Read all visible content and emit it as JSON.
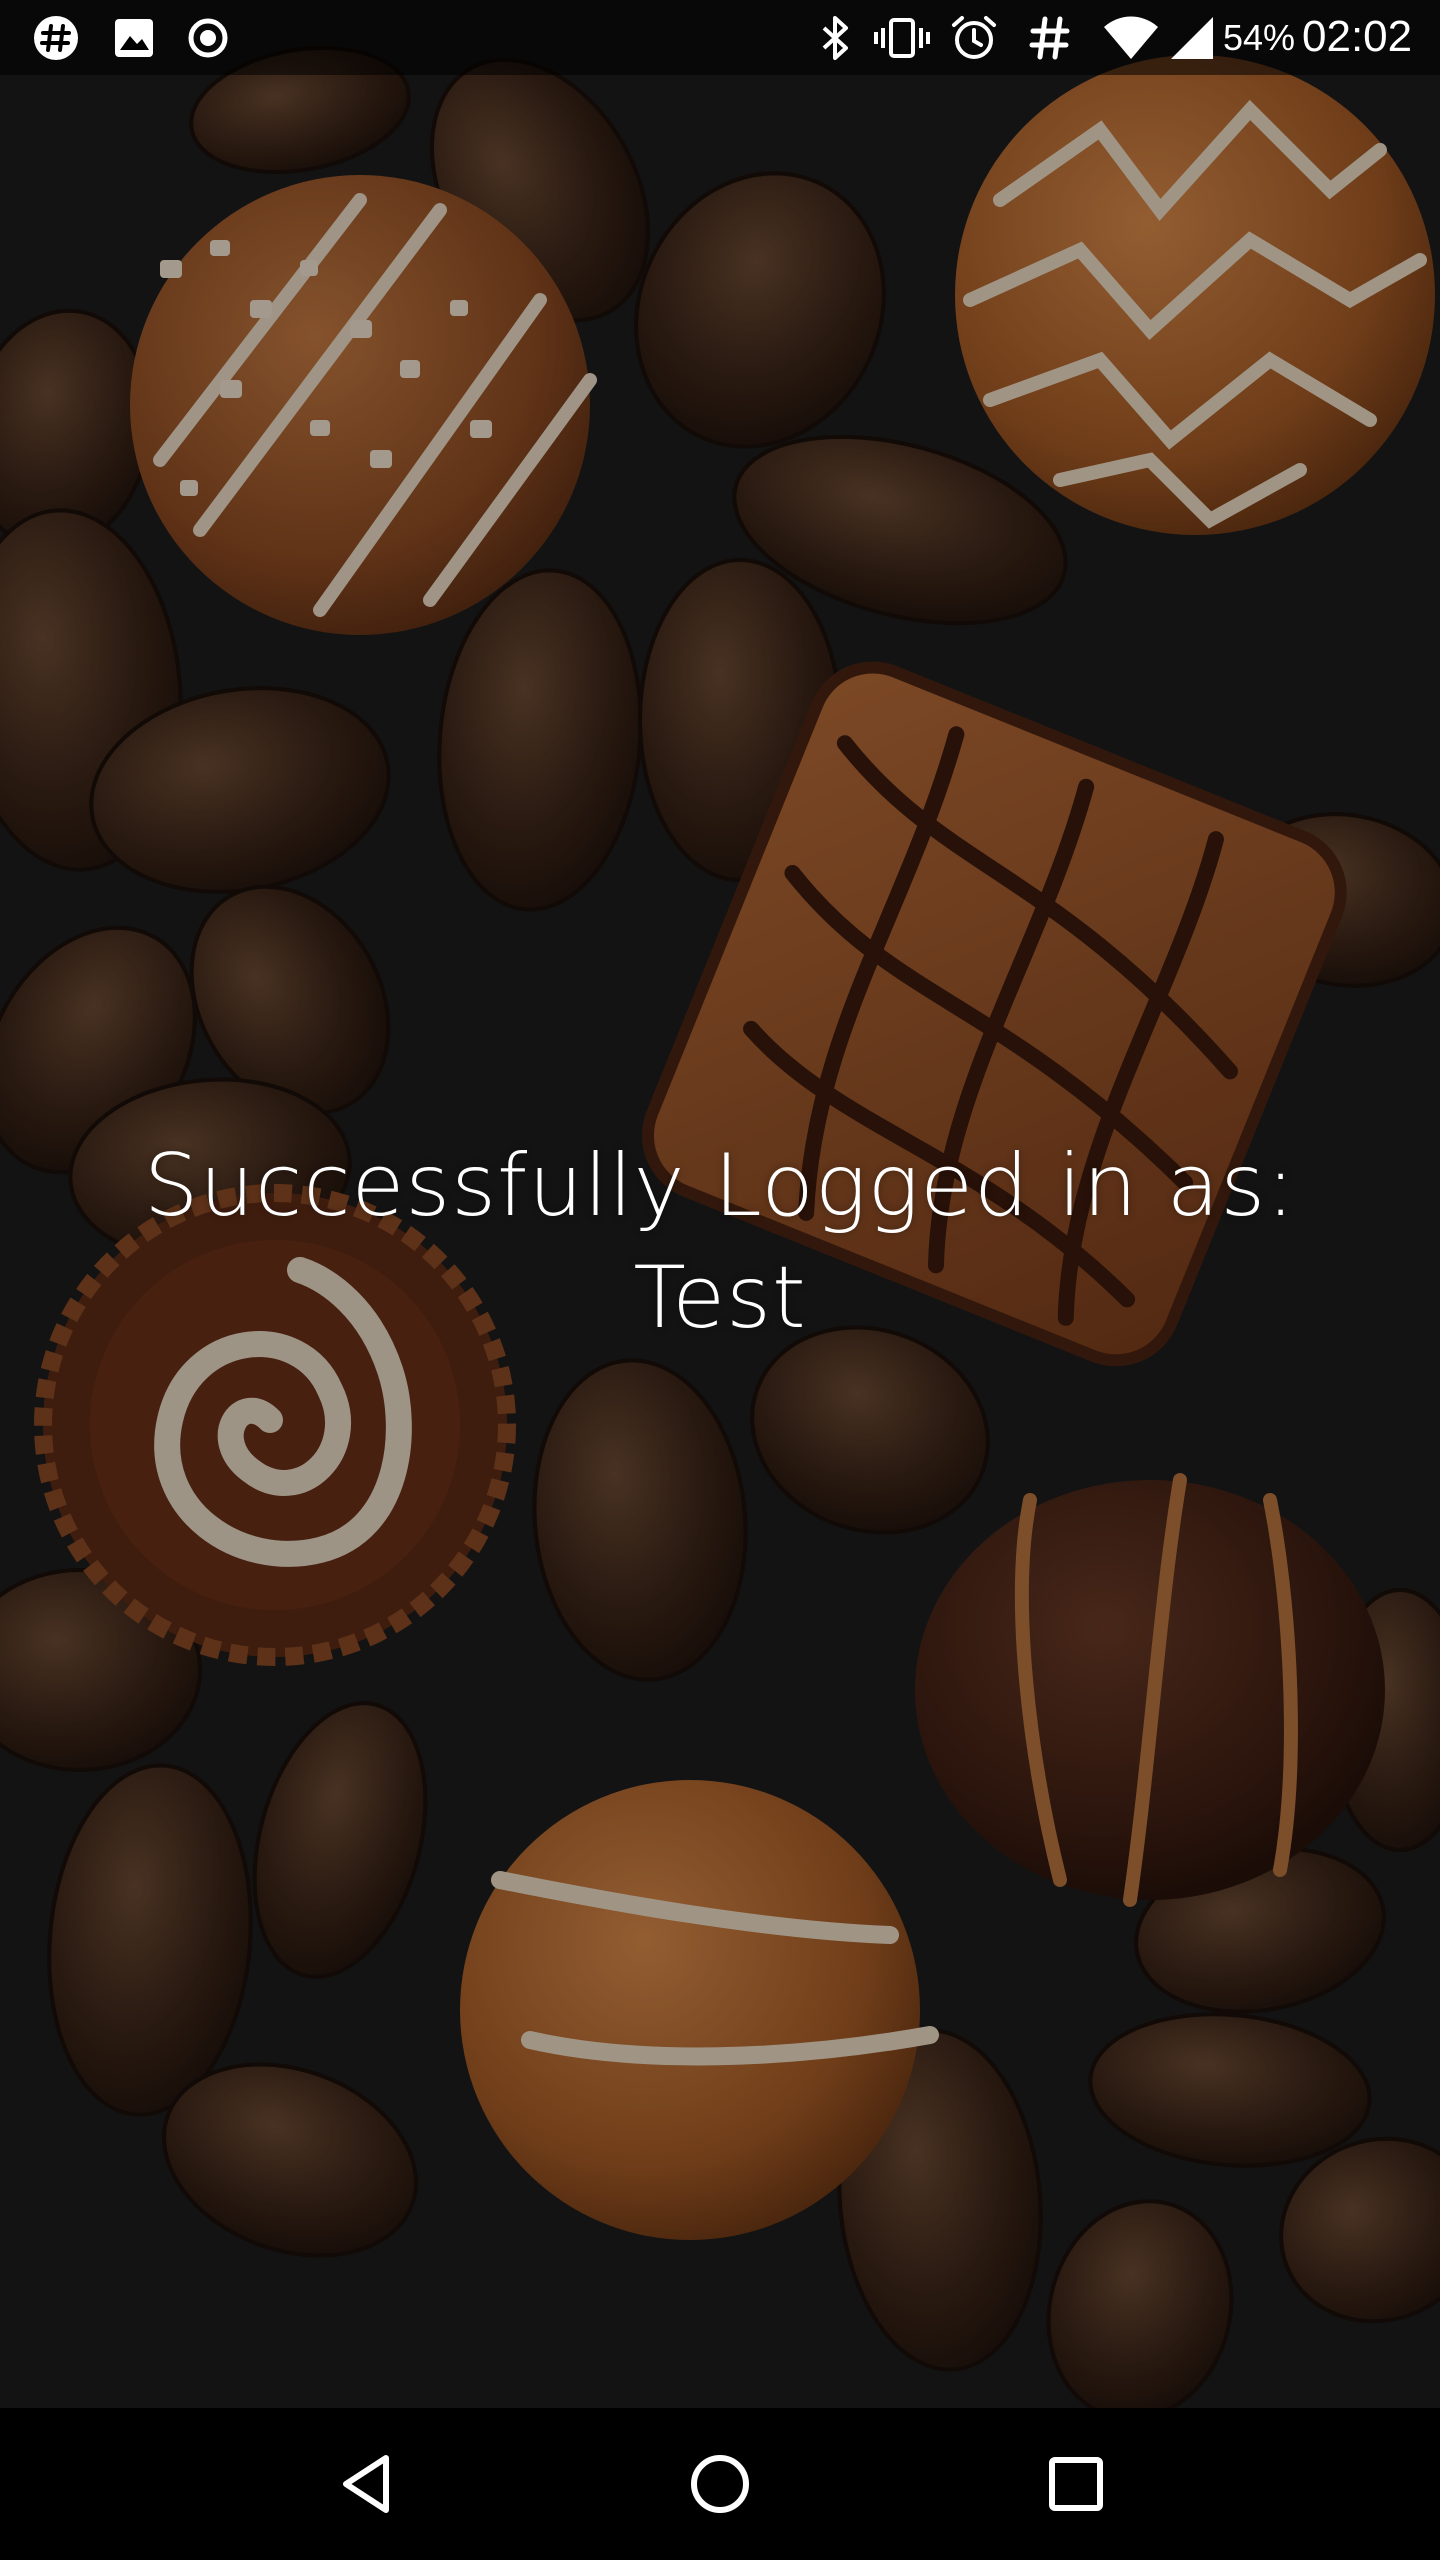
{
  "status_bar": {
    "left_icons": [
      "hashtag-app-icon",
      "image-icon",
      "record-icon"
    ],
    "right_icons": [
      "bluetooth-icon",
      "vibrate-icon",
      "alarm-icon",
      "hashtag-icon",
      "wifi-icon",
      "signal-icon"
    ],
    "battery_percent": "54%",
    "clock": "02:02"
  },
  "message": {
    "line1": "Successfully Logged in as:",
    "line2": "Test"
  },
  "nav_bar": {
    "buttons": [
      "back-icon",
      "home-icon",
      "recents-icon"
    ]
  },
  "colors": {
    "background": "#1e1e20",
    "text": "#ffffff",
    "nav_bar": "#000000",
    "chocolate_dark": "#3a2418",
    "chocolate_milk": "#a0582c",
    "cream_stripe": "#e9d9bf"
  }
}
